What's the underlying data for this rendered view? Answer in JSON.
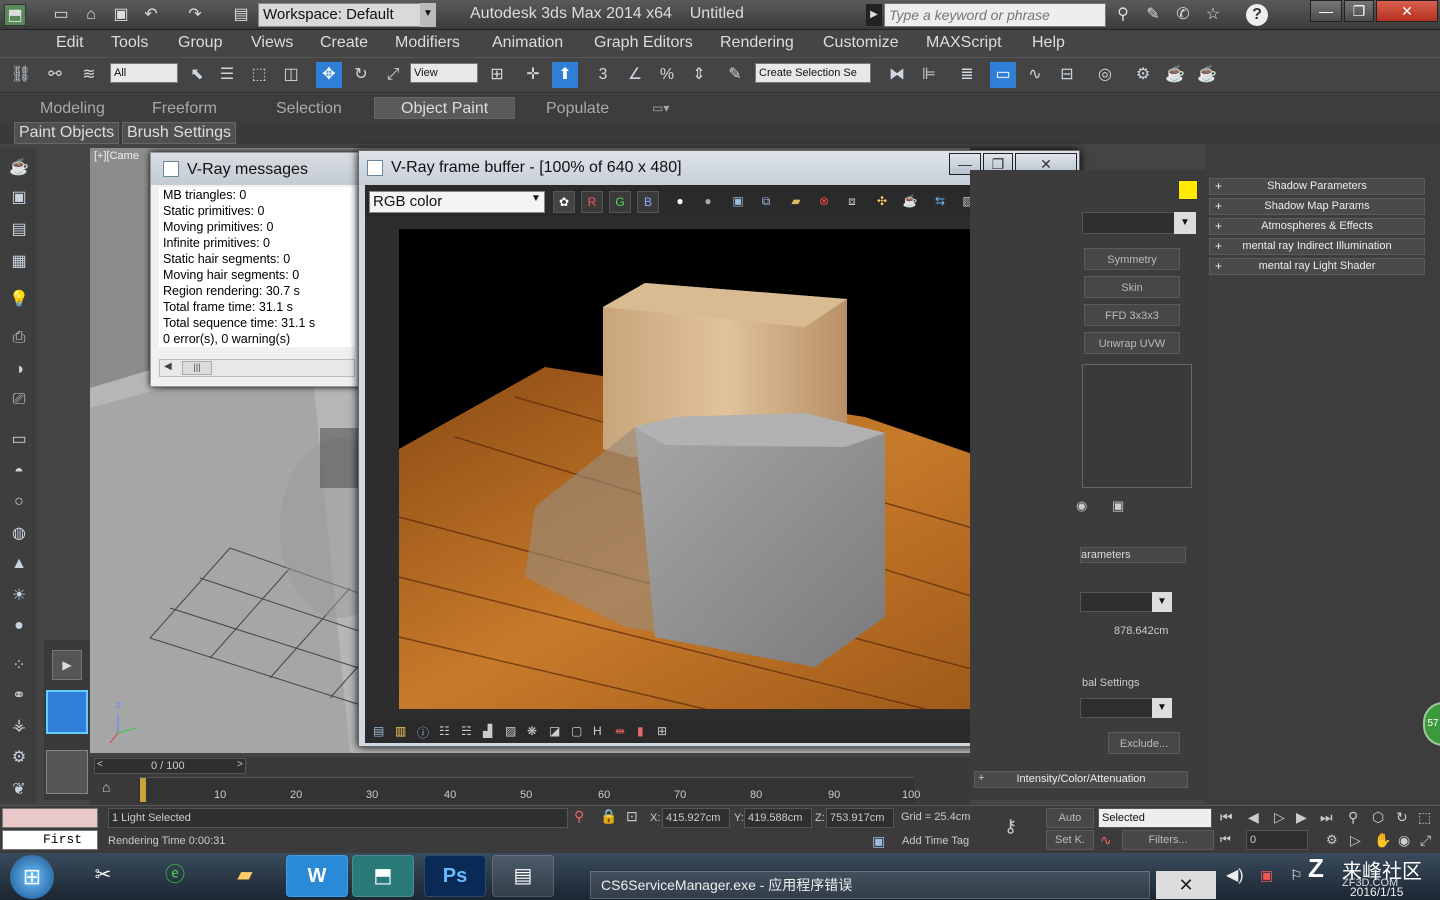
{
  "app": {
    "title": "Autodesk 3ds Max  2014 x64",
    "doc": "Untitled",
    "workspace": "Workspace: Default",
    "search_placeholder": "Type a keyword or phrase"
  },
  "menu": [
    "Edit",
    "Tools",
    "Group",
    "Views",
    "Create",
    "Modifiers",
    "Animation",
    "Graph Editors",
    "Rendering",
    "Customize",
    "MAXScript",
    "Help"
  ],
  "toolbar": {
    "filter": "All",
    "ref_coord": "View",
    "selection_set": "Create Selection Se"
  },
  "ribbon": {
    "tabs": [
      "Modeling",
      "Freeform",
      "Selection",
      "Object Paint",
      "Populate"
    ],
    "active": "Object Paint",
    "subtabs": [
      "Paint Objects",
      "Brush Settings"
    ]
  },
  "viewport": {
    "label": "[+][Came"
  },
  "vray_messages": {
    "title": "V-Ray messages",
    "lines": [
      "MB triangles: 0",
      "Static primitives: 0",
      "Moving primitives: 0",
      "Infinite primitives: 0",
      "Static hair segments: 0",
      "Moving hair segments: 0",
      "Region rendering: 30.7 s",
      "Total frame time: 31.1 s",
      "Total sequence time: 31.1 s",
      "0 error(s), 0 warning(s)",
      "=============================="
    ]
  },
  "vray_fb": {
    "title": "V-Ray frame buffer - [100% of 640 x 480]",
    "channel": "RGB color",
    "btn_r": "R",
    "btn_g": "G",
    "btn_b": "B"
  },
  "command_panel": {
    "rollouts": [
      "Shadow Parameters",
      "Shadow Map Params",
      "Atmospheres & Effects",
      "mental ray Indirect Illumination",
      "mental ray Light Shader"
    ],
    "modifiers": [
      "Symmetry",
      "Skin",
      "FFD 3x3x3",
      "Unwrap UVW"
    ],
    "params_label": "arameters",
    "distance": "878.642cm",
    "global_label": "bal Settings",
    "exclude": "Exclude...",
    "intensity_rollout": "Intensity/Color/Attenuation"
  },
  "timeline": {
    "frame": "0 / 100",
    "ticks": [
      "10",
      "20",
      "30",
      "40",
      "50",
      "60",
      "70",
      "80",
      "90",
      "100"
    ]
  },
  "status": {
    "maxscript": "First",
    "selected": "1 Light Selected",
    "render_time": "Rendering Time  0:00:31",
    "x": "415.927cm",
    "y": "419.588cm",
    "z": "753.917cm",
    "grid": "Grid = 25.4cm",
    "add_time_tag": "Add Time Tag",
    "auto": "Auto",
    "setk": "Set K.",
    "key_mode": "Selected",
    "filters": "Filters...",
    "frame_field": "0"
  },
  "taskbar": {
    "error_window": "CS6ServiceManager.exe - 应用程序错误",
    "watermark": "来峰社区",
    "watermark_sub": "ZF3D.COM",
    "date": "2016/1/15"
  },
  "colors": {
    "accent": "#ffea00",
    "selected_tool": "#2f7fd6"
  }
}
